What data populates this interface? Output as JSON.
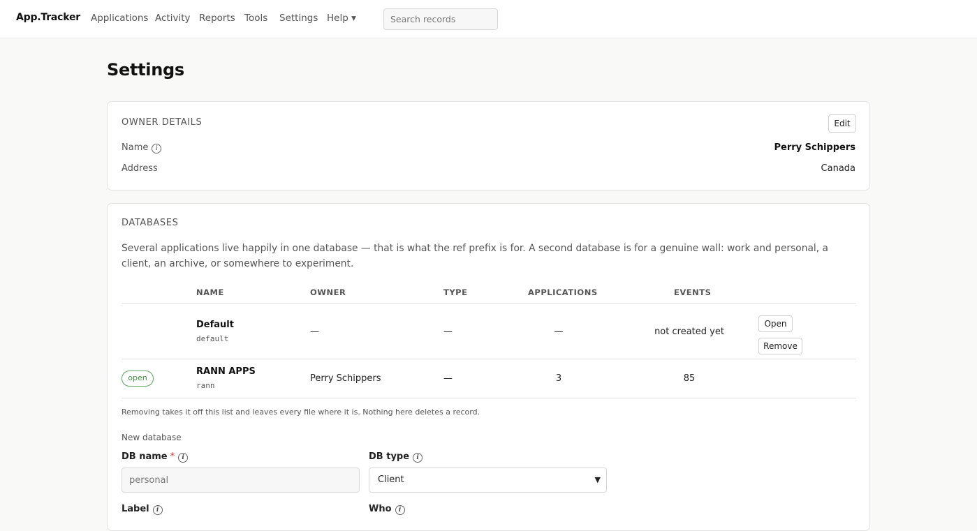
{
  "brand": "App.Tracker",
  "nav": {
    "applications": "Applications",
    "activity": "Activity",
    "reports": "Reports",
    "tools": "Tools",
    "settings": "Settings",
    "help": "Help ▾"
  },
  "search": {
    "placeholder": "Search records",
    "value": ""
  },
  "page_title": "Settings",
  "owner": {
    "heading": "OWNER DETAILS",
    "edit_label": "Edit",
    "name_label": "Name",
    "name_value": "Perry Schippers",
    "address_label": "Address",
    "address_value": "Canada"
  },
  "databases": {
    "heading": "DATABASES",
    "description": "Several applications live happily in one database — that is what the ref prefix is for. A second database is for a genuine wall: work and personal, a client, an archive, or somewhere to experiment.",
    "columns": {
      "name": "NAME",
      "owner": "OWNER",
      "type": "TYPE",
      "applications": "APPLICATIONS",
      "events": "EVENTS"
    },
    "rows": [
      {
        "status": "",
        "name": "Default",
        "code": "default",
        "owner": "—",
        "type": "—",
        "applications": "—",
        "events": "not created yet",
        "open_label": "Open",
        "remove_label": "Remove"
      },
      {
        "status": "open",
        "name": "RANN APPS",
        "code": "rann",
        "owner": "Perry Schippers",
        "type": "—",
        "applications": "3",
        "events": "85"
      }
    ],
    "note": "Removing takes it off this list and leaves every file where it is. Nothing here deletes a record.",
    "new_db": {
      "heading": "New database",
      "db_name_label": "DB name",
      "required_mark": "*",
      "db_name_placeholder": "personal",
      "db_type_label": "DB type",
      "db_type_value": "Client",
      "label_label": "Label",
      "who_label": "Who"
    }
  },
  "icons": {
    "info": "info-circle-icon",
    "chevron": "chevron-down-icon"
  }
}
